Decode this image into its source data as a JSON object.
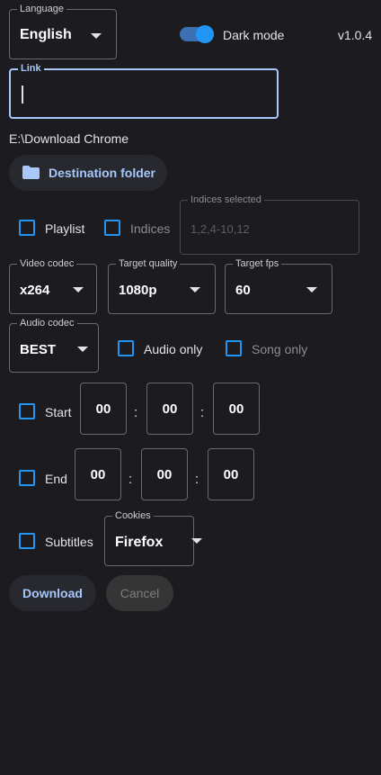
{
  "header": {
    "language_legend": "Language",
    "language_value": "English",
    "dark_mode_label": "Dark mode",
    "dark_mode_on": true,
    "version": "v1.0.4"
  },
  "link": {
    "legend": "Link",
    "value": ""
  },
  "destination": {
    "path": "E:\\Download Chrome",
    "button_label": "Destination folder",
    "icon": "folder-icon"
  },
  "playlist": {
    "playlist_label": "Playlist",
    "indices_label": "Indices",
    "indices_legend": "Indices selected",
    "indices_placeholder": "1,2,4-10,12"
  },
  "video": {
    "codec_legend": "Video codec",
    "codec_value": "x264",
    "quality_legend": "Target quality",
    "quality_value": "1080p",
    "fps_legend": "Target fps",
    "fps_value": "60"
  },
  "audio": {
    "codec_legend": "Audio codec",
    "codec_value": "BEST",
    "audio_only_label": "Audio only",
    "song_only_label": "Song only"
  },
  "start": {
    "label": "Start",
    "hh": "00",
    "mm": "00",
    "ss": "00",
    "sep": ":"
  },
  "end": {
    "label": "End",
    "hh": "00",
    "mm": "00",
    "ss": "00",
    "sep": ":"
  },
  "subtitles": {
    "label": "Subtitles",
    "cookies_legend": "Cookies",
    "cookies_value": "Firefox"
  },
  "actions": {
    "download_label": "Download",
    "cancel_label": "Cancel"
  },
  "colors": {
    "background": "#1c1b1f",
    "accent": "#2196f3",
    "accent_light": "#a8c7fa",
    "button_bg": "#27292f"
  }
}
